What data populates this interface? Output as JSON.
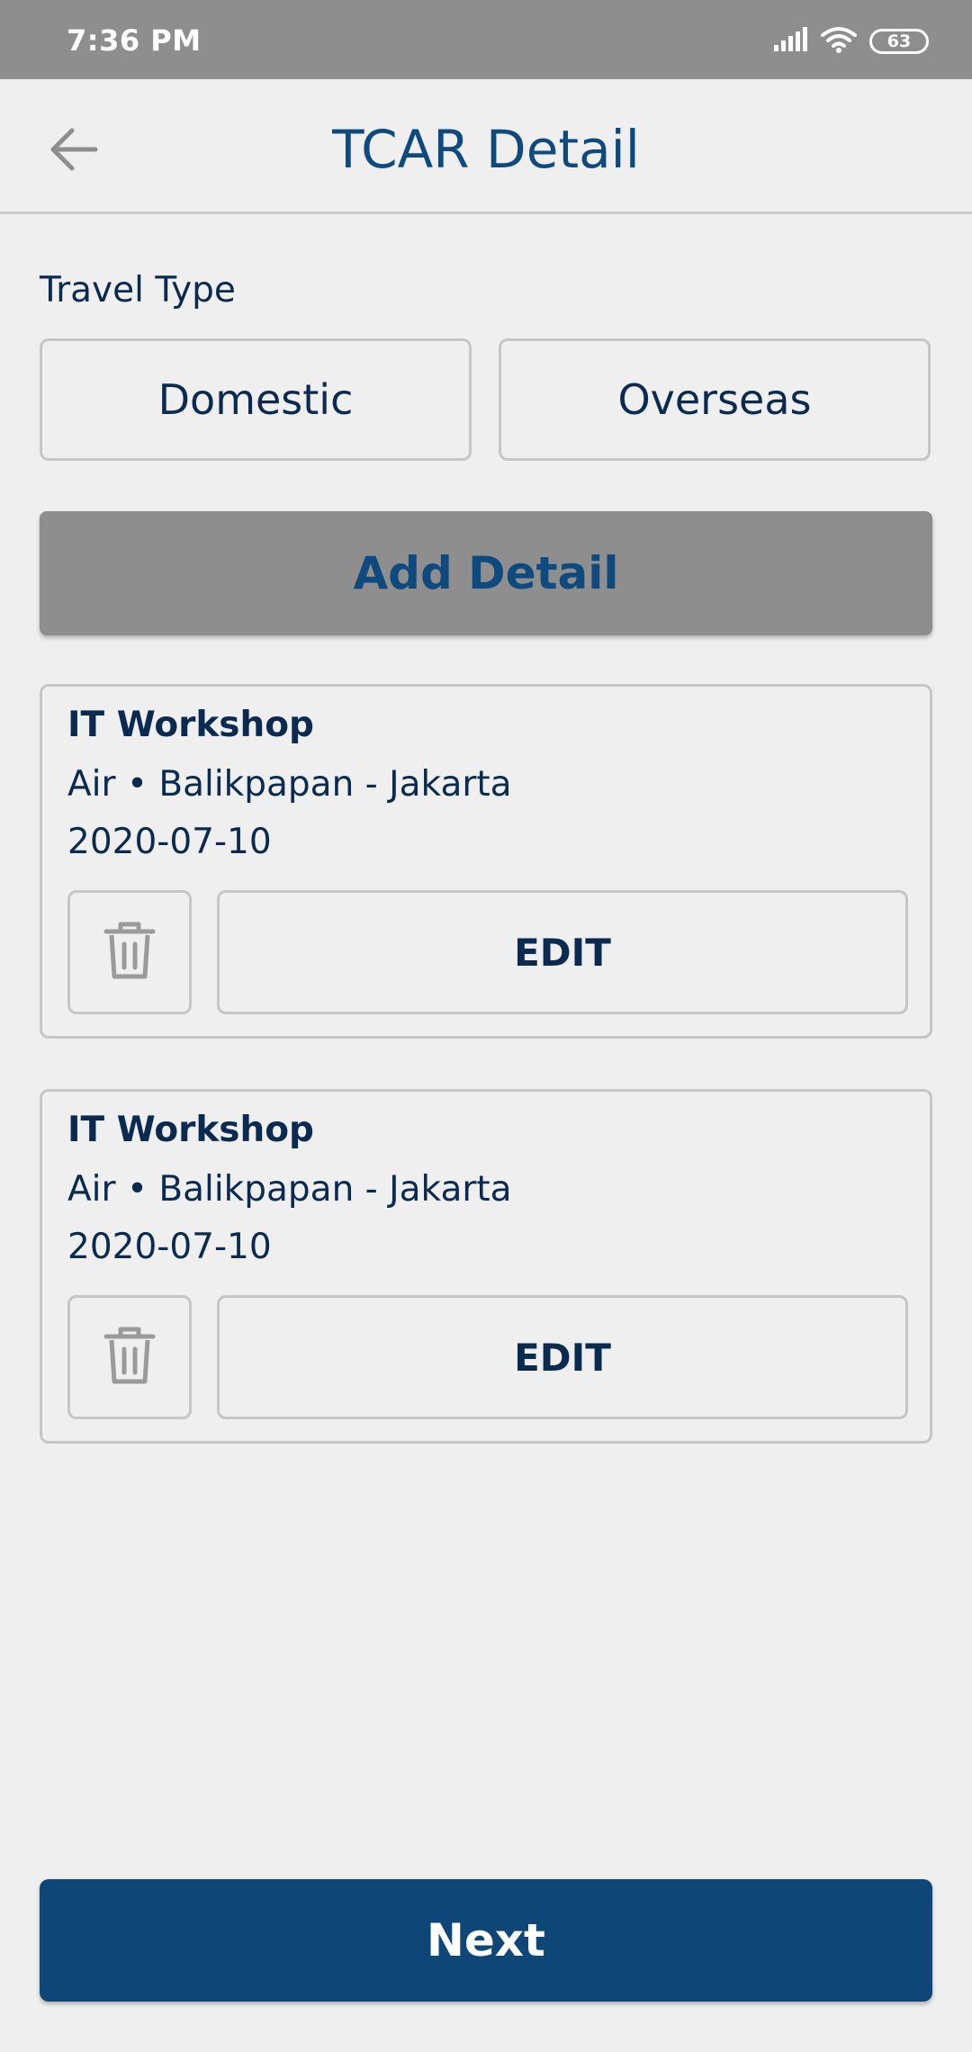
{
  "status_bar": {
    "time": "7:36 PM",
    "battery": "63",
    "icons": [
      "signal-icon",
      "wifi-icon",
      "battery-icon"
    ]
  },
  "header": {
    "title": "TCAR Detail",
    "back_icon": "arrow-left-icon"
  },
  "travel_type": {
    "label": "Travel Type",
    "options": [
      "Domestic",
      "Overseas"
    ]
  },
  "add_detail_label": "Add Detail",
  "details": [
    {
      "title": "IT Workshop",
      "route": "Air • Balikpapan - Jakarta",
      "date": "2020-07-10",
      "edit_label": "EDIT",
      "delete_icon": "trash-icon"
    },
    {
      "title": "IT Workshop",
      "route": "Air • Balikpapan - Jakarta",
      "date": "2020-07-10",
      "edit_label": "EDIT",
      "delete_icon": "trash-icon"
    }
  ],
  "next_label": "Next",
  "colors": {
    "primary": "#0d4677",
    "text_dark": "#0b2a4f",
    "status_bar": "#8e8e8e",
    "add_button_bg": "#8e8e8e",
    "background": "#efefef",
    "border": "#c6c6c6"
  }
}
